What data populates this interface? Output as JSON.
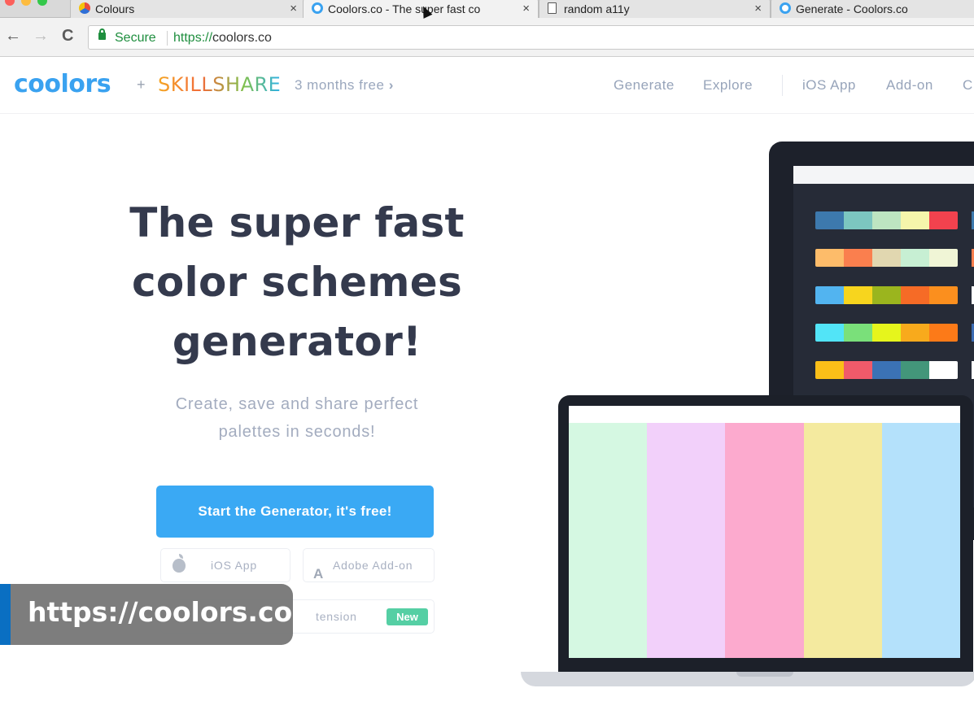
{
  "browser": {
    "tabs": [
      {
        "title": "Colours",
        "favicon_color": "#e94b3c"
      },
      {
        "title": "Coolors.co - The super fast co",
        "favicon_color": "#3aa2f0"
      },
      {
        "title": "random a11y",
        "favicon_color": "#888888"
      },
      {
        "title": "Generate - Coolors.co",
        "favicon_color": "#3aa2f0"
      }
    ],
    "nav": {
      "back": "←",
      "forward": "→",
      "reload": "C"
    },
    "address": {
      "secure_label": "Secure",
      "scheme": "https://",
      "host": "coolors.co"
    }
  },
  "site": {
    "logo": "coolors",
    "plus": "+",
    "partner": "SKILLSHARE",
    "promo": "3 months free",
    "promo_chevron": "›",
    "nav": [
      {
        "label": "Generate"
      },
      {
        "label": "Explore"
      },
      {
        "label": "iOS App"
      },
      {
        "label": "Add-on"
      },
      {
        "label": "C"
      }
    ]
  },
  "hero": {
    "headline_lines": [
      "The super fast",
      "color schemes",
      "generator!"
    ],
    "subhead_lines": [
      "Create, save and share perfect",
      "palettes in seconds!"
    ],
    "cta": "Start the Generator, it's free!",
    "ios_button": "iOS App",
    "adobe_button": "Adobe Add-on",
    "chrome_button_partial": "tension",
    "new_badge": "New"
  },
  "overlay": {
    "caption": "https://coolors.co"
  },
  "mockup": {
    "monitor_palettes": [
      [
        "#3d79ad",
        "#7cc6c0",
        "#bde5c1",
        "#f5f5ab",
        "#f2424e"
      ],
      [
        "#fdbc6a",
        "#fa7f4e",
        "#e1d7b0",
        "#c7efd3",
        "#f0f5d6"
      ],
      [
        "#52b4f0",
        "#f7d51e",
        "#9bb51e",
        "#f66b26",
        "#fb8f1e"
      ],
      [
        "#52e4f7",
        "#7ae07a",
        "#e6f51c",
        "#f8aa1c",
        "#fc7a18"
      ],
      [
        "#fbbf18",
        "#f05a6a",
        "#3b72b5",
        "#43967a",
        "#ffffff"
      ]
    ],
    "monitor_edge_colors": [
      "#3d79ad",
      "#fa7f4e",
      "#ffffff",
      "#3b6bb3",
      "#ffffff"
    ],
    "laptop_palette": [
      "#d5f8e2",
      "#f2d0fa",
      "#fcaace",
      "#f4ea9f",
      "#b4e1fb"
    ]
  },
  "colors": {
    "brand_blue": "#3aa2f0",
    "headline": "#343a4d",
    "muted": "#97a4ba",
    "cta": "#3aa9f4",
    "badge": "#55cfa4"
  }
}
